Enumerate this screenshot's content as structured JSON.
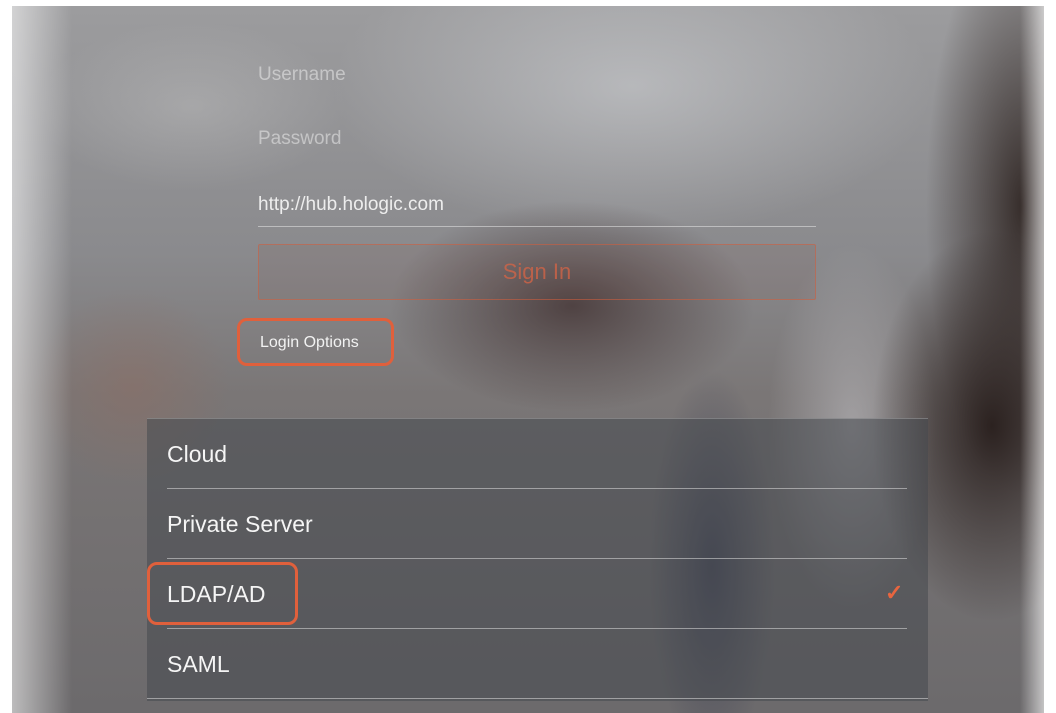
{
  "form": {
    "username_placeholder": "Username",
    "password_placeholder": "Password",
    "server_value": "http://hub.hologic.com",
    "sign_in_label": "Sign In",
    "login_options_label": "Login Options"
  },
  "login_options": {
    "items": [
      {
        "label": "Cloud",
        "selected": false
      },
      {
        "label": "Private Server",
        "selected": false
      },
      {
        "label": "LDAP/AD",
        "selected": true
      },
      {
        "label": "SAML",
        "selected": false
      }
    ],
    "check_glyph": "✓",
    "check_icon": "checkmark-icon"
  },
  "colors": {
    "accent": "#e0603c",
    "checkmark": "#e8653f"
  }
}
